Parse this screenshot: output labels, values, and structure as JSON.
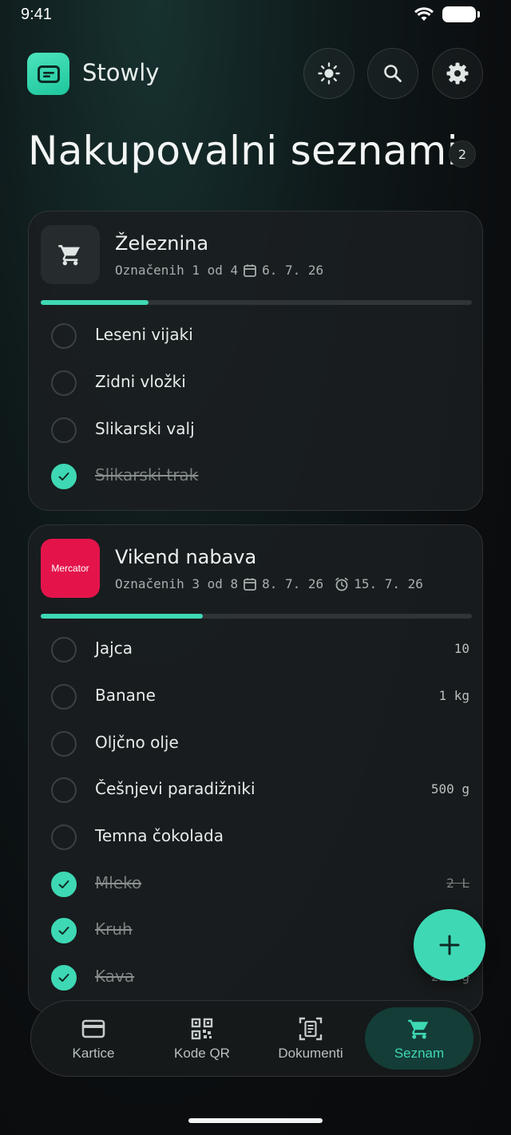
{
  "status": {
    "time": "9:41"
  },
  "app": {
    "name": "Stowly"
  },
  "header": {
    "buttons": [
      "theme-toggle",
      "search",
      "settings"
    ]
  },
  "page": {
    "title": "Nakupovalni seznami",
    "list_count": "2"
  },
  "lists": [
    {
      "title": "Železnina",
      "thumb": "cart-icon",
      "checked_text": "Označenih 1 od 4",
      "date": "6. 7. 26",
      "progress": 0.25,
      "items": [
        {
          "label": "Leseni vijaki",
          "qty": "",
          "done": false
        },
        {
          "label": "Zidni vložki",
          "qty": "",
          "done": false
        },
        {
          "label": "Slikarski valj",
          "qty": "",
          "done": false
        },
        {
          "label": "Slikarski trak",
          "qty": "",
          "done": true
        }
      ]
    },
    {
      "title": "Vikend nabava",
      "thumb_text": "Mercator",
      "brand_color": "#e4144b",
      "checked_text": "Označenih 3 od 8",
      "date": "8. 7. 26",
      "reminder": "15. 7. 26",
      "progress": 0.375,
      "items": [
        {
          "label": "Jajca",
          "qty": "10",
          "done": false
        },
        {
          "label": "Banane",
          "qty": "1 kg",
          "done": false
        },
        {
          "label": "Oljčno olje",
          "qty": "",
          "done": false
        },
        {
          "label": "Češnjevi paradižniki",
          "qty": "500 g",
          "done": false
        },
        {
          "label": "Temna čokolada",
          "qty": "",
          "done": false
        },
        {
          "label": "Mleko",
          "qty": "2 L",
          "done": true
        },
        {
          "label": "Kruh",
          "qty": "",
          "done": true
        },
        {
          "label": "Kava",
          "qty": "250 g",
          "done": true
        }
      ]
    }
  ],
  "nav": {
    "items": [
      {
        "label": "Kartice",
        "icon": "card-icon"
      },
      {
        "label": "Kode QR",
        "icon": "qr-icon"
      },
      {
        "label": "Dokumenti",
        "icon": "document-icon"
      },
      {
        "label": "Seznam",
        "icon": "cart-icon"
      }
    ],
    "active_index": 3
  },
  "colors": {
    "accent": "#3ed8b4",
    "background": "#0b0d0f",
    "card": "#1a1e20"
  }
}
